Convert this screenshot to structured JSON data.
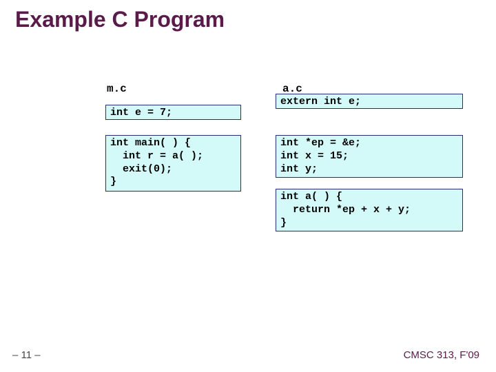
{
  "title": "Example C Program",
  "files": {
    "m": {
      "name": "m.c",
      "decl": "int e = 7;",
      "main": "int main( ) {\n  int r = a( );\n  exit(0);\n}"
    },
    "a": {
      "name": "a.c",
      "extern": "extern int e;",
      "decls": "int *ep = &e;\nint x = 15;\nint y;",
      "func": "int a( ) {\n  return *ep + x + y;\n}"
    }
  },
  "footer": {
    "page": "– 11 –",
    "course": "CMSC 313, F'09"
  }
}
